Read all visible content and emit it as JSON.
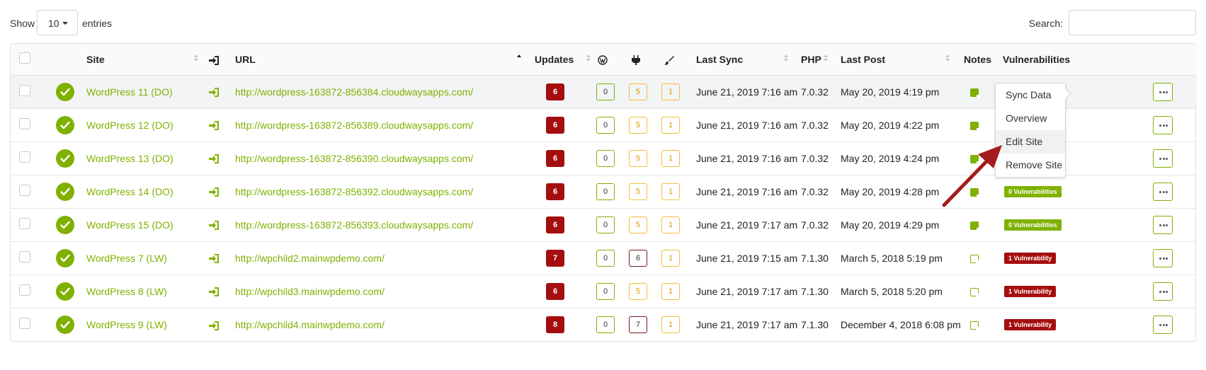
{
  "controls": {
    "show_label": "Show",
    "entries_value": "10",
    "entries_label": "entries",
    "search_label": "Search:",
    "search_value": ""
  },
  "table": {
    "headers": {
      "site": "Site",
      "url": "URL",
      "updates": "Updates",
      "last_sync": "Last Sync",
      "php": "PHP",
      "last_post": "Last Post",
      "notes": "Notes",
      "vulnerabilities": "Vulnerabilities"
    },
    "rows": [
      {
        "site": "WordPress 11 (DO)",
        "url": "http://wordpress-163872-856384.cloudwaysapps.com/",
        "updates": "6",
        "wp": "0",
        "plugins": "5",
        "themes": "1",
        "last_sync": "June 21, 2019 7:16 am",
        "php": "7.0.32",
        "last_post": "May 20, 2019 4:19 pm",
        "vuln": ""
      },
      {
        "site": "WordPress 12 (DO)",
        "url": "http://wordpress-163872-856389.cloudwaysapps.com/",
        "updates": "6",
        "wp": "0",
        "plugins": "5",
        "themes": "1",
        "last_sync": "June 21, 2019 7:16 am",
        "php": "7.0.32",
        "last_post": "May 20, 2019 4:22 pm",
        "vuln": ""
      },
      {
        "site": "WordPress 13 (DO)",
        "url": "http://wordpress-163872-856390.cloudwaysapps.com/",
        "updates": "6",
        "wp": "0",
        "plugins": "5",
        "themes": "1",
        "last_sync": "June 21, 2019 7:16 am",
        "php": "7.0.32",
        "last_post": "May 20, 2019 4:24 pm",
        "vuln": ""
      },
      {
        "site": "WordPress 14 (DO)",
        "url": "http://wordpress-163872-856392.cloudwaysapps.com/",
        "updates": "6",
        "wp": "0",
        "plugins": "5",
        "themes": "1",
        "last_sync": "June 21, 2019 7:16 am",
        "php": "7.0.32",
        "last_post": "May 20, 2019 4:28 pm",
        "vuln": "0 Vulnerabilities"
      },
      {
        "site": "WordPress 15 (DO)",
        "url": "http://wordpress-163872-856393.cloudwaysapps.com/",
        "updates": "6",
        "wp": "0",
        "plugins": "5",
        "themes": "1",
        "last_sync": "June 21, 2019 7:17 am",
        "php": "7.0.32",
        "last_post": "May 20, 2019 4:29 pm",
        "vuln": "0 Vulnerabilities"
      },
      {
        "site": "WordPress 7 (LW)",
        "url": "http://wpchild2.mainwpdemo.com/",
        "updates": "7",
        "wp": "0",
        "plugins": "6",
        "themes": "1",
        "last_sync": "June 21, 2019 7:15 am",
        "php": "7.1.30",
        "last_post": "March 5, 2018 5:19 pm",
        "vuln": "1 Vulnerability"
      },
      {
        "site": "WordPress 8 (LW)",
        "url": "http://wpchild3.mainwpdemo.com/",
        "updates": "6",
        "wp": "0",
        "plugins": "5",
        "themes": "1",
        "last_sync": "June 21, 2019 7:17 am",
        "php": "7.1.30",
        "last_post": "March 5, 2018 5:20 pm",
        "vuln": "1 Vulnerability"
      },
      {
        "site": "WordPress 9 (LW)",
        "url": "http://wpchild4.mainwpdemo.com/",
        "updates": "8",
        "wp": "0",
        "plugins": "7",
        "themes": "1",
        "last_sync": "June 21, 2019 7:17 am",
        "php": "7.1.30",
        "last_post": "December 4, 2018 6:08 pm",
        "vuln": "1 Vulnerability"
      }
    ]
  },
  "dropdown": {
    "items": [
      "Sync Data",
      "Overview",
      "Edit Site",
      "Remove Site"
    ]
  },
  "colors": {
    "accent": "#7fb100",
    "danger": "#a50e0e",
    "warning": "#f2c037"
  }
}
